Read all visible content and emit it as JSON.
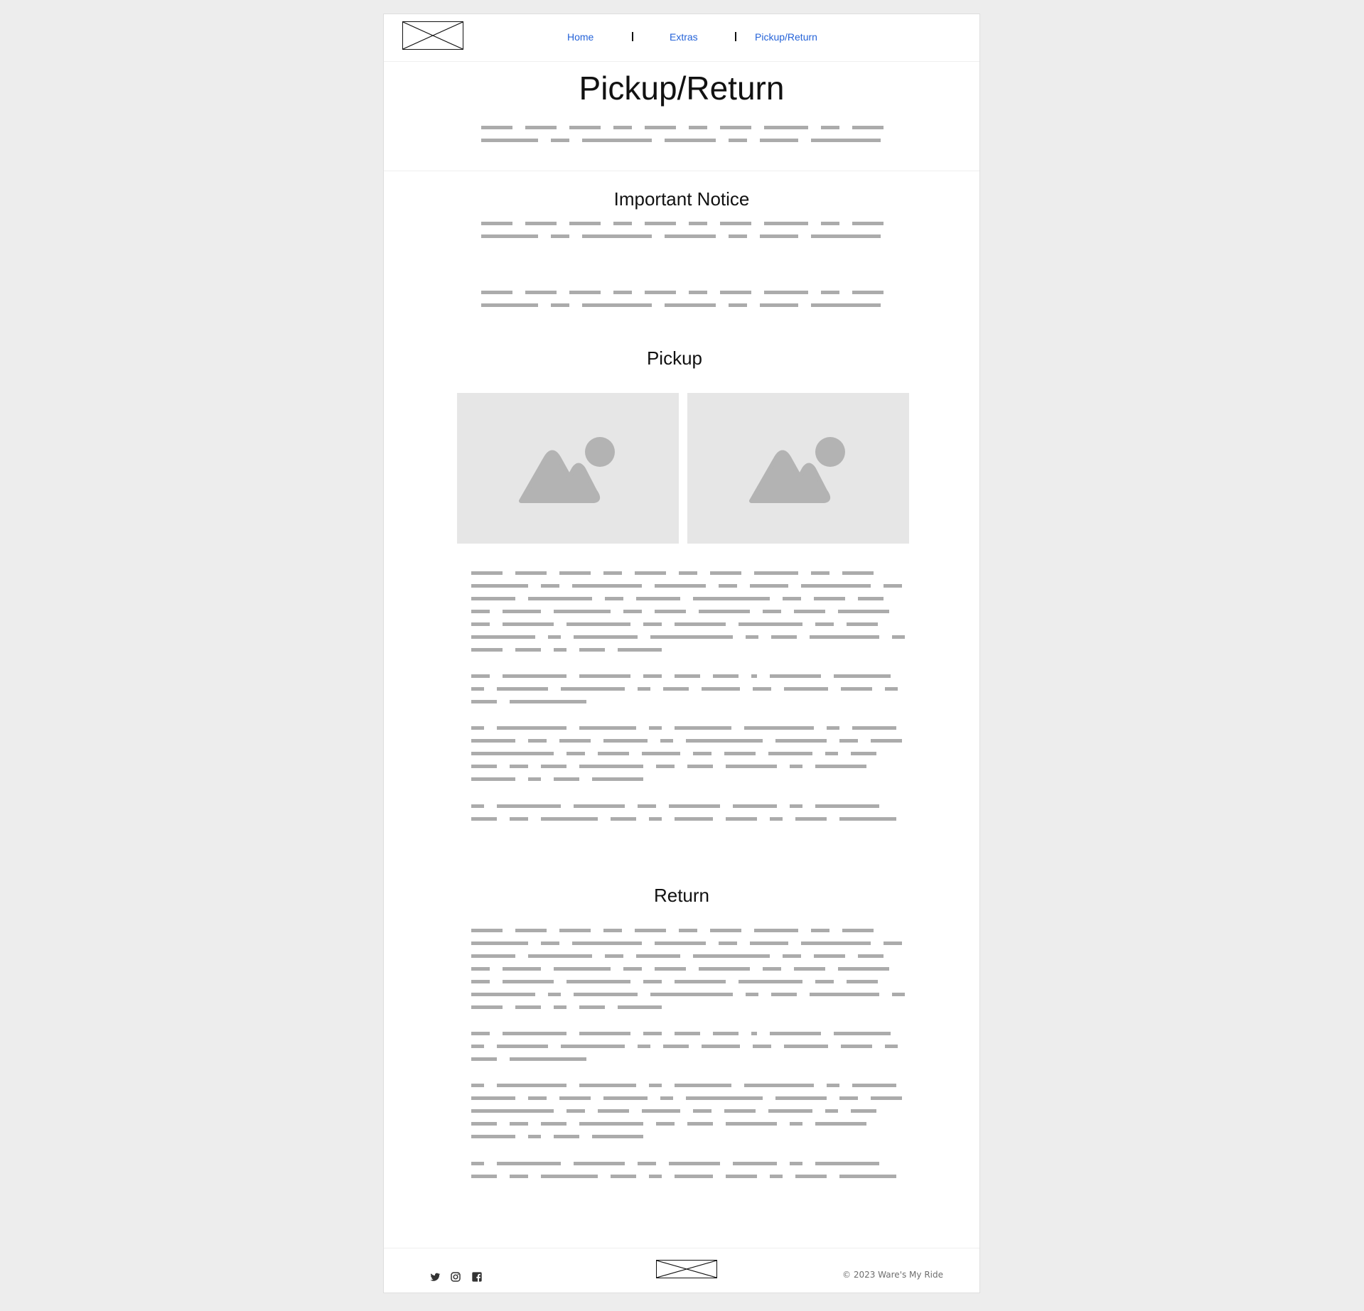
{
  "header": {
    "nav": [
      {
        "label": "Home"
      },
      {
        "label": "Extras"
      },
      {
        "label": "Pickup/Return"
      }
    ]
  },
  "hero": {
    "title": "Pickup/Return"
  },
  "sections": {
    "notice_title": "Important Notice",
    "pickup_title": "Pickup",
    "return_title": "Return"
  },
  "footer": {
    "social_icons": [
      "twitter-icon",
      "instagram-icon",
      "facebook-icon"
    ],
    "copyright": "© 2023 Ware's My Ride"
  },
  "colors": {
    "link": "#2563d8",
    "placeholder_text": "#ababab",
    "image_bg": "#e6e6e6",
    "image_glyph": "#b3b3b3",
    "page_bg": "#ededed"
  }
}
